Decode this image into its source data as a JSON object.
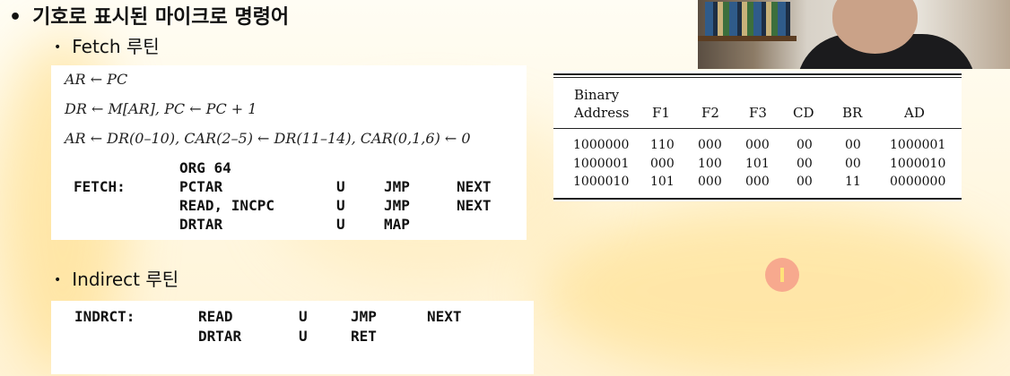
{
  "slide": {
    "title_bullet": "•",
    "title": "기호로 표시된 마이크로 명령어",
    "sub_bullet": "•",
    "fetch_heading": "Fetch 루틴",
    "indirect_heading": "Indirect 루틴"
  },
  "fetch_rtl": [
    "AR ← PC",
    "DR ← M[AR],    PC ← PC + 1",
    "AR ← DR(0–10),    CAR(2–5) ← DR(11–14),    CAR(0,1,6) ← 0"
  ],
  "fetch_asm": {
    "org": "ORG 64",
    "rows": [
      {
        "label": "FETCH:",
        "ops": "PCTAR",
        "cd": "U",
        "br": "JMP",
        "ad": "NEXT"
      },
      {
        "label": "",
        "ops": "READ, INCPC",
        "cd": "U",
        "br": "JMP",
        "ad": "NEXT"
      },
      {
        "label": "",
        "ops": "DRTAR",
        "cd": "U",
        "br": "MAP",
        "ad": ""
      }
    ]
  },
  "indirect_asm": {
    "rows": [
      {
        "label": "INDRCT:",
        "ops": "READ",
        "cd": "U",
        "br": "JMP",
        "ad": "NEXT"
      },
      {
        "label": "",
        "ops": "DRTAR",
        "cd": "U",
        "br": "RET",
        "ad": ""
      }
    ]
  },
  "binary_table": {
    "headers": {
      "binary": "Binary",
      "address": "Address",
      "f1": "F1",
      "f2": "F2",
      "f3": "F3",
      "cd": "CD",
      "br": "BR",
      "ad": "AD"
    },
    "rows": [
      [
        "1000000",
        "110",
        "000",
        "000",
        "00",
        "00",
        "1000001"
      ],
      [
        "1000001",
        "000",
        "100",
        "101",
        "00",
        "00",
        "1000010"
      ],
      [
        "1000010",
        "101",
        "000",
        "000",
        "00",
        "11",
        "0000000"
      ]
    ]
  }
}
